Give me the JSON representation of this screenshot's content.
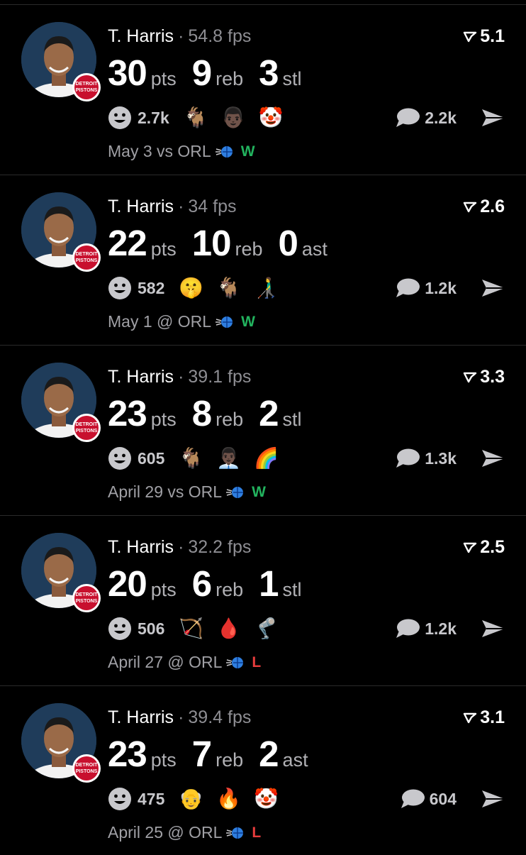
{
  "colors": {
    "win": "#22b35e",
    "loss": "#e63c3c",
    "muted": "#8e8e93",
    "background": "#000000",
    "pistons_red": "#c8102e",
    "avatar_bg": "#1f3c5a"
  },
  "icons": {
    "reaction": "smiley-face-icon",
    "comment": "speech-bubble-icon",
    "share": "paper-plane-icon",
    "rating": "flag-icon",
    "team": "orlando-magic-logo-icon",
    "badge": "detroit-pistons-logo-icon"
  },
  "posts": [
    {
      "player": "T. Harris",
      "separator": "·",
      "fps": "54.8 fps",
      "rating": "5.1",
      "badge_text": "DETROIT PISTONS",
      "stats": [
        {
          "value": "30",
          "unit": "pts"
        },
        {
          "value": "9",
          "unit": "reb"
        },
        {
          "value": "3",
          "unit": "stl"
        }
      ],
      "reactions_count": "2.7k",
      "emojis": [
        "🐐",
        "👨🏿",
        "🤡"
      ],
      "comments_count": "2.2k",
      "game_prefix": "May 3 vs ORL",
      "result": "W"
    },
    {
      "player": "T. Harris",
      "separator": "·",
      "fps": "34 fps",
      "rating": "2.6",
      "badge_text": "DETROIT PISTONS",
      "stats": [
        {
          "value": "22",
          "unit": "pts"
        },
        {
          "value": "10",
          "unit": "reb"
        },
        {
          "value": "0",
          "unit": "ast"
        }
      ],
      "reactions_count": "582",
      "emojis": [
        "🤫",
        "🐐",
        "👨‍🦯"
      ],
      "comments_count": "1.2k",
      "game_prefix": "May 1 @ ORL",
      "result": "W"
    },
    {
      "player": "T. Harris",
      "separator": "·",
      "fps": "39.1 fps",
      "rating": "3.3",
      "badge_text": "DETROIT PISTONS",
      "stats": [
        {
          "value": "23",
          "unit": "pts"
        },
        {
          "value": "8",
          "unit": "reb"
        },
        {
          "value": "2",
          "unit": "stl"
        }
      ],
      "reactions_count": "605",
      "emojis": [
        "🐐",
        "👨🏿‍💼",
        "🌈"
      ],
      "comments_count": "1.3k",
      "game_prefix": "April 29 vs ORL",
      "result": "W"
    },
    {
      "player": "T. Harris",
      "separator": "·",
      "fps": "32.2 fps",
      "rating": "2.5",
      "badge_text": "DETROIT PISTONS",
      "stats": [
        {
          "value": "20",
          "unit": "pts"
        },
        {
          "value": "6",
          "unit": "reb"
        },
        {
          "value": "1",
          "unit": "stl"
        }
      ],
      "reactions_count": "506",
      "emojis": [
        "🏹",
        "🩸",
        "🦿"
      ],
      "comments_count": "1.2k",
      "game_prefix": "April 27 @ ORL",
      "result": "L"
    },
    {
      "player": "T. Harris",
      "separator": "·",
      "fps": "39.4 fps",
      "rating": "3.1",
      "badge_text": "DETROIT PISTONS",
      "stats": [
        {
          "value": "23",
          "unit": "pts"
        },
        {
          "value": "7",
          "unit": "reb"
        },
        {
          "value": "2",
          "unit": "ast"
        }
      ],
      "reactions_count": "475",
      "emojis": [
        "👴",
        "🔥",
        "🤡"
      ],
      "comments_count": "604",
      "game_prefix": "April 25 @ ORL",
      "result": "L"
    }
  ]
}
